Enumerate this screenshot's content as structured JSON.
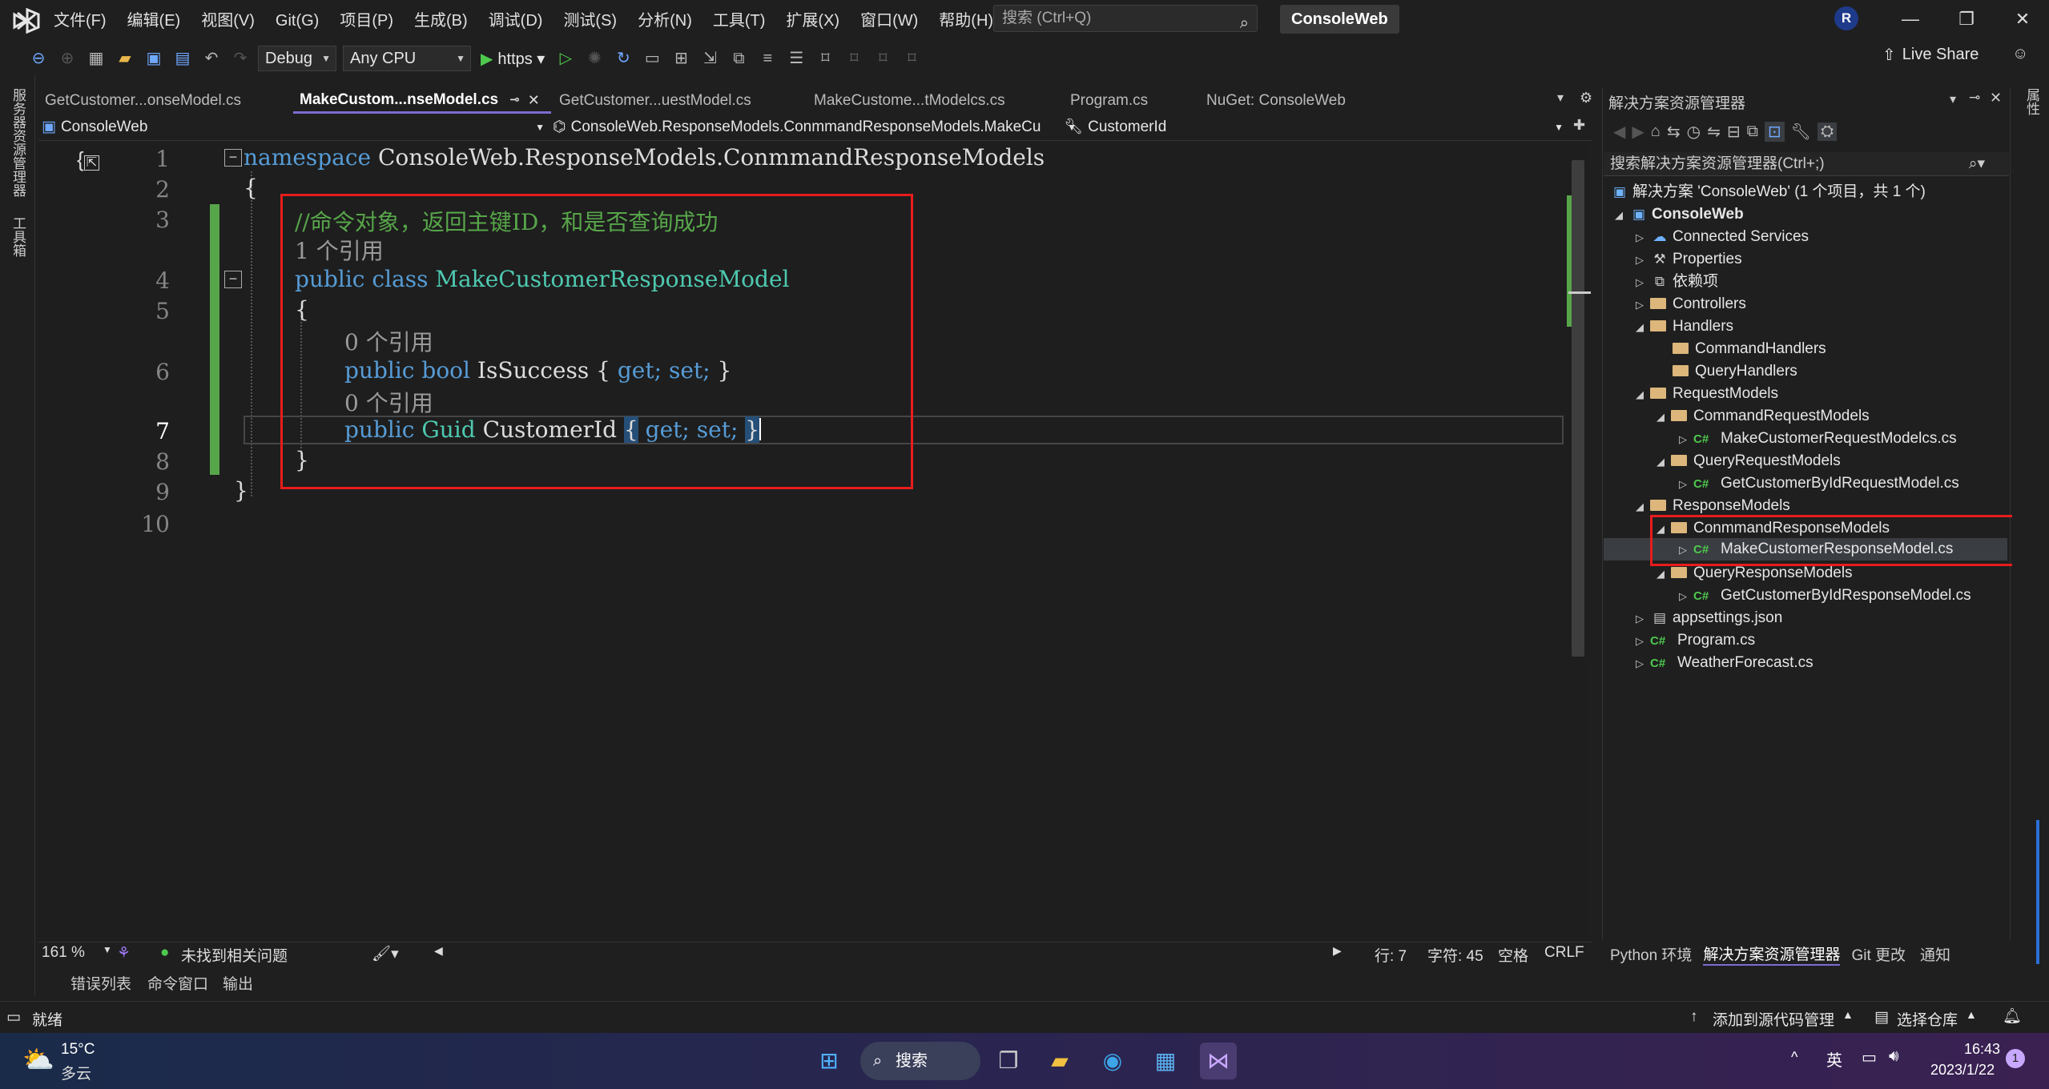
{
  "menu": [
    "文件(F)",
    "编辑(E)",
    "视图(V)",
    "Git(G)",
    "项目(P)",
    "生成(B)",
    "调试(D)",
    "测试(S)",
    "分析(N)",
    "工具(T)",
    "扩展(X)",
    "窗口(W)",
    "帮助(H)"
  ],
  "search": {
    "placeholder": "搜索 (Ctrl+Q)"
  },
  "solution_badge": "ConsoleWeb",
  "user_initial": "R",
  "toolbar": {
    "config": "Debug",
    "platform": "Any CPU",
    "run_label": "https",
    "live_share": "Live Share"
  },
  "left_strip": {
    "server_explorer": "服务器资源管理器",
    "toolbox": "工具箱"
  },
  "right_strip": {
    "properties": "属性"
  },
  "tabs": [
    {
      "label": "GetCustomer...onseModel.cs"
    },
    {
      "label": "MakeCustom...nseModel.cs"
    },
    {
      "label": "GetCustomer...uestModel.cs"
    },
    {
      "label": "MakeCustome...tModelcs.cs"
    },
    {
      "label": "Program.cs"
    },
    {
      "label": "NuGet: ConsoleWeb"
    }
  ],
  "navbar": {
    "project": "ConsoleWeb",
    "type": "ConsoleWeb.ResponseModels.ConmmandResponseModels.MakeCu",
    "member": "CustomerId"
  },
  "code": {
    "line_numbers": [
      "1",
      "2",
      "3",
      "4",
      "5",
      "6",
      "7",
      "8",
      "9",
      "10"
    ],
    "ns_keyword": "namespace",
    "ns_name": "ConsoleWeb.ResponseModels.ConmmandResponseModels",
    "comment": "//命令对象，返回主键ID，和是否查询成功",
    "ref_class": "1 个引用",
    "public": "public",
    "class_kw": "class",
    "class_name": "MakeCustomerResponseModel",
    "ref_prop1": "0 个引用",
    "bool_kw": "bool",
    "prop1": "IsSuccess",
    "ref_prop2": "0 个引用",
    "guid_type": "Guid",
    "prop2": "CustomerId",
    "get": "get;",
    "set": "set;",
    "open": "{",
    "close": "}"
  },
  "editor_status": {
    "zoom": "161 %",
    "issues": "未找到相关问题",
    "line": "行: 7",
    "col": "字符: 45",
    "spaces": "空格",
    "eol": "CRLF"
  },
  "bottom_tabs": [
    "错误列表",
    "命令窗口",
    "输出"
  ],
  "solution_explorer": {
    "title": "解决方案资源管理器",
    "search_placeholder": "搜索解决方案资源管理器(Ctrl+;)",
    "solution": "解决方案 'ConsoleWeb' (1 个项目，共 1 个)",
    "project": "ConsoleWeb",
    "items": [
      {
        "label": "Connected Services"
      },
      {
        "label": "Properties"
      },
      {
        "label": "依赖项"
      },
      {
        "label": "Controllers"
      },
      {
        "label": "Handlers"
      },
      {
        "label": "CommandHandlers"
      },
      {
        "label": "QueryHandlers"
      },
      {
        "label": "RequestModels"
      },
      {
        "label": "CommandRequestModels"
      },
      {
        "label": "MakeCustomerRequestModelcs.cs"
      },
      {
        "label": "QueryRequestModels"
      },
      {
        "label": "GetCustomerByIdRequestModel.cs"
      },
      {
        "label": "ResponseModels"
      },
      {
        "label": "ConmmandResponseModels"
      },
      {
        "label": "MakeCustomerResponseModel.cs"
      },
      {
        "label": "QueryResponseModels"
      },
      {
        "label": "GetCustomerByIdResponseModel.cs"
      },
      {
        "label": "appsettings.json"
      },
      {
        "label": "Program.cs"
      },
      {
        "label": "WeatherForecast.cs"
      }
    ],
    "bottom_tabs": [
      "Python 环境",
      "解决方案资源管理器",
      "Git 更改",
      "通知"
    ]
  },
  "status": {
    "ready": "就绪",
    "add_source": "添加到源代码管理",
    "select_repo": "选择仓库"
  },
  "taskbar": {
    "weather_temp": "15°C",
    "weather_desc": "多云",
    "search": "搜索",
    "ime": "英",
    "time": "16:43",
    "date": "2023/1/22",
    "notif_count": "1"
  }
}
